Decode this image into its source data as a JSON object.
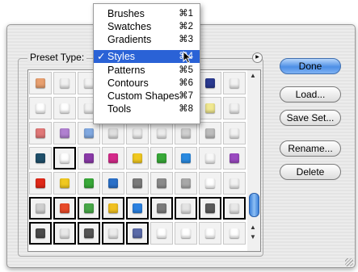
{
  "dialog": {
    "preset_label": "Preset Type:",
    "buttons": {
      "done": "Done",
      "load": "Load...",
      "save_set": "Save Set...",
      "rename": "Rename...",
      "delete": "Delete"
    },
    "flyout_icon": "right-arrow-icon"
  },
  "menu": {
    "items": [
      {
        "label": "Brushes",
        "shortcut": "⌘1"
      },
      {
        "label": "Swatches",
        "shortcut": "⌘2"
      },
      {
        "label": "Gradients",
        "shortcut": "⌘3"
      },
      {
        "label": "Styles",
        "shortcut": "⌘4",
        "checked": true,
        "highlighted": true
      },
      {
        "label": "Patterns",
        "shortcut": "⌘5"
      },
      {
        "label": "Contours",
        "shortcut": "⌘6"
      },
      {
        "label": "Custom Shapes",
        "shortcut": "⌘7"
      },
      {
        "label": "Tools",
        "shortcut": "⌘8"
      }
    ],
    "check_mark": "✓"
  },
  "grid": {
    "rows": [
      [
        {
          "c": "#e8a070"
        },
        {
          "c": "#f0f0f0"
        },
        {
          "c": "#f4f4f4"
        },
        {
          "c": "#f4f4f4"
        },
        {
          "c": "#f4f4f4"
        },
        {
          "c": "#f4f4f4"
        },
        {
          "c": "#e6d870"
        },
        {
          "c": "#2a3a90"
        },
        {
          "c": "#f2f2f2"
        }
      ],
      [
        {
          "c": "#ffffff"
        },
        {
          "c": "#ffffff"
        },
        {
          "c": "#f2f2f2"
        },
        {
          "c": "#f2f2f2"
        },
        {
          "c": "#f2f2f2"
        },
        {
          "c": "#f2f2f2"
        },
        {
          "c": "#f2f2f2"
        },
        {
          "c": "#f0e890"
        },
        {
          "c": "#f2f2f2"
        }
      ],
      [
        {
          "c": "#e07878"
        },
        {
          "c": "#b080d0"
        },
        {
          "c": "#80a8e0"
        },
        {
          "c": "#e0e0e0"
        },
        {
          "c": "#ececec"
        },
        {
          "c": "#ececec"
        },
        {
          "c": "#d0d0d0"
        },
        {
          "c": "#bcbcbc"
        },
        {
          "c": "#f2f2f2"
        }
      ],
      [
        {
          "c": "#1f4f6a"
        },
        {
          "c": "#ffffff",
          "sel": true
        },
        {
          "c": "#8a3aa8"
        },
        {
          "c": "#d42a8a"
        },
        {
          "c": "#f0c820"
        },
        {
          "c": "#38a838"
        },
        {
          "c": "#2a8ae0"
        },
        {
          "c": "#f8f8f8"
        },
        {
          "c": "#9a4ac0"
        }
      ],
      [
        {
          "c": "#e02818"
        },
        {
          "c": "#f0c820"
        },
        {
          "c": "#38a838"
        },
        {
          "c": "#2a70c8"
        },
        {
          "c": "#7a7a7a"
        },
        {
          "c": "#8a8a8a"
        },
        {
          "c": "#a8a8a8"
        },
        {
          "c": "#ffffff"
        },
        {
          "c": "#f2f2f2"
        }
      ],
      [
        {
          "c": "#cfcfcf",
          "sel": true
        },
        {
          "c": "#e84a28",
          "sel": true
        },
        {
          "c": "#48a848",
          "sel": true
        },
        {
          "c": "#f0c020",
          "sel": true
        },
        {
          "c": "#2a80e0",
          "sel": true
        },
        {
          "c": "#7a7a7a",
          "sel": true
        },
        {
          "c": "#e4e4e4",
          "sel": true
        },
        {
          "c": "#5a5a5a",
          "sel": true
        },
        {
          "c": "#e8e8e8",
          "sel": true
        }
      ],
      [
        {
          "c": "#4a4a4a",
          "sel": true
        },
        {
          "c": "#e8e8e8",
          "sel": true
        },
        {
          "c": "#555555",
          "sel": true
        },
        {
          "c": "#ececec",
          "sel": true
        },
        {
          "c": "#5a6aa8",
          "sel": true
        },
        {
          "c": "#ffffff"
        },
        {
          "c": "#ffffff"
        },
        {
          "c": "#ffffff"
        },
        {
          "c": "#ffffff"
        }
      ]
    ]
  },
  "scrollbar": {
    "up_icon": "▲",
    "down_icon": "▼"
  },
  "colors": {
    "highlight": "#2a62d6",
    "done_button": "#4d8fe6"
  }
}
